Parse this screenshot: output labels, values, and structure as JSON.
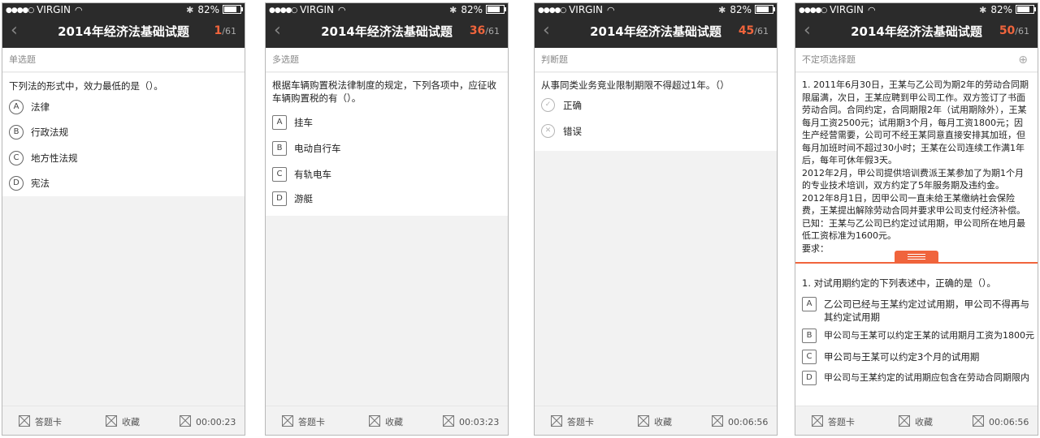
{
  "status": {
    "carrier": "VIRGIN",
    "battery": "82%",
    "battery_level": 0.82
  },
  "app": {
    "title": "2014年经济法基础试题",
    "total": "/61",
    "back_icon": "chevron-left-icon"
  },
  "colors": {
    "accent": "#f0643c",
    "header_bg": "#2b2b2b"
  },
  "footer": {
    "answer_card": "答题卡",
    "favorite": "收藏"
  },
  "screens": [
    {
      "current": "1",
      "category": "单选题",
      "question": "下列法的形式中，效力最低的是（）。",
      "options": [
        {
          "key": "A",
          "text": "法律"
        },
        {
          "key": "B",
          "text": "行政法规"
        },
        {
          "key": "C",
          "text": "地方性法规"
        },
        {
          "key": "D",
          "text": "宪法"
        }
      ],
      "timer": "00:00:23"
    },
    {
      "current": "36",
      "category": "多选题",
      "question": "根据车辆购置税法律制度的规定，下列各项中，应征收车辆购置税的有（）。",
      "options": [
        {
          "key": "A",
          "text": "挂车"
        },
        {
          "key": "B",
          "text": "电动自行车"
        },
        {
          "key": "C",
          "text": "有轨电车"
        },
        {
          "key": "D",
          "text": "游艇"
        }
      ],
      "timer": "00:03:23"
    },
    {
      "current": "45",
      "category": "判断题",
      "question": "从事同类业务竞业限制期限不得超过1年。（）",
      "options": [
        {
          "icon": "check-circle-icon",
          "text": "正确"
        },
        {
          "icon": "x-circle-icon",
          "text": "错误"
        }
      ],
      "timer": "00:06:56"
    },
    {
      "current": "50",
      "category": "不定项选择题",
      "material": [
        "1. 2011年6月30日，王某与乙公司为期2年的劳动合同期限届满，次日，王某应聘到甲公司工作。双方签订了书面劳动合同。合同约定，合同期限2年（试用期除外），王某每月工资2500元；试用期3个月，每月工资1800元；因生产经营需要，公司可不经王某同意直接安排其加班，但每月加班时间不超过30小时；王某在公司连续工作满1年后，每年可休年假3天。",
        "2012年2月，甲公司提供培训费派王某参加了为期1个月的专业技术培训，双方约定了5年服务期及违约金。",
        "2012年8月1日，因甲公司一直未给王某缴纳社会保险费，王某提出解除劳动合同并要求甲公司支付经济补偿。",
        "已知：王某与乙公司已约定过试用期，甲公司所在地月最低工资标准为1600元。",
        "要求："
      ],
      "question": "1. 对试用期约定的下列表述中，正确的是（）。",
      "options": [
        {
          "key": "A",
          "text": "乙公司已经与王某约定过试用期，甲公司不得再与其约定试用期"
        },
        {
          "key": "B",
          "text": "甲公司与王某可以约定王某的试用期月工资为1800元"
        },
        {
          "key": "C",
          "text": "甲公司与王某可以约定3个月的试用期"
        },
        {
          "key": "D",
          "text": "甲公司与王某约定的试用期应包含在劳动合同期限内"
        }
      ],
      "timer": "00:06:56"
    }
  ]
}
